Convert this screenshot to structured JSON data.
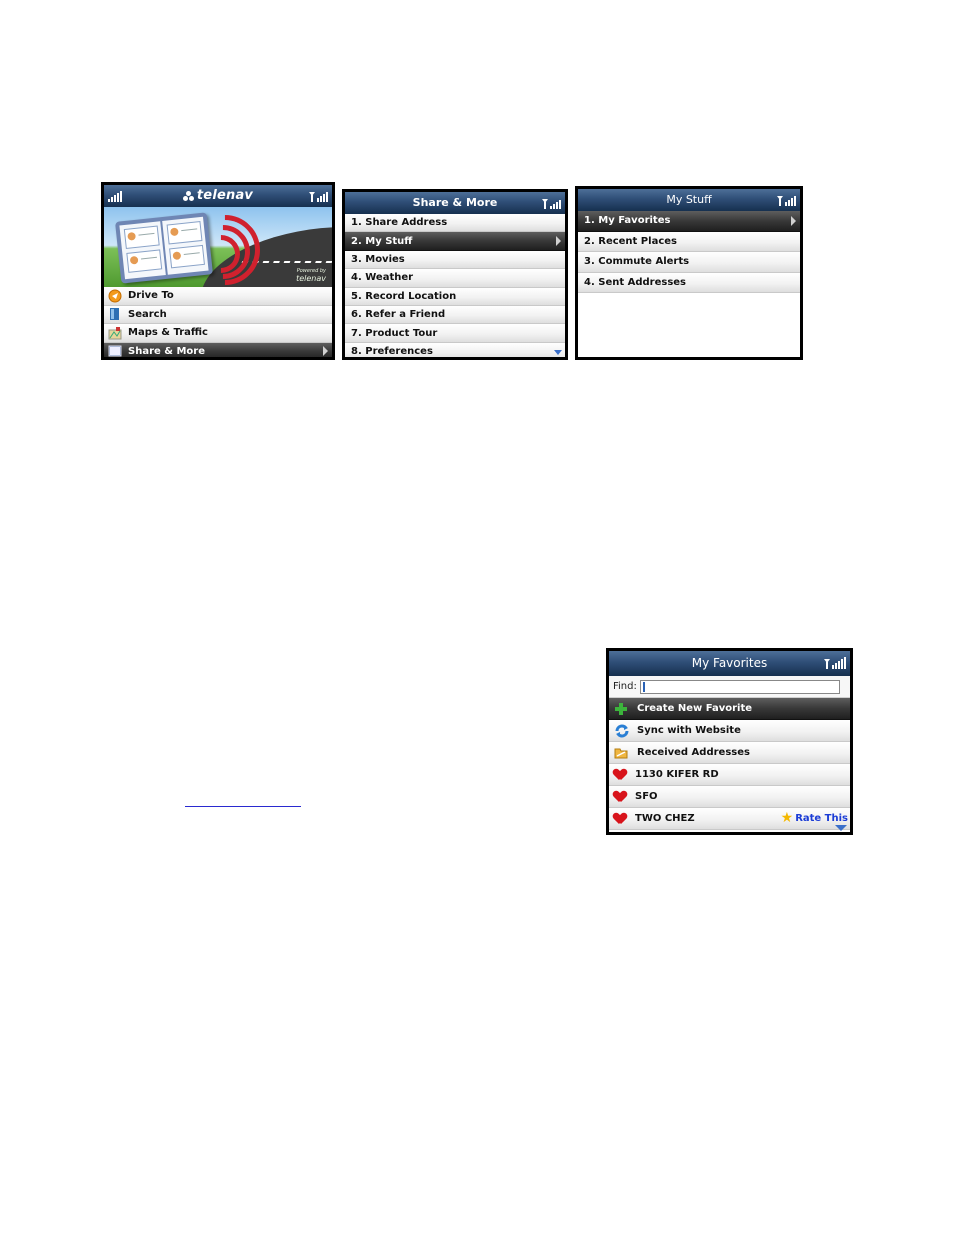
{
  "screen1": {
    "logo": "telenav",
    "powered_by": "Powered by",
    "powered_logo": "telenav",
    "items": [
      {
        "label": "Drive To",
        "icon": "drive-to-icon"
      },
      {
        "label": "Search",
        "icon": "search-book-icon"
      },
      {
        "label": "Maps & Traffic",
        "icon": "map-traffic-icon"
      },
      {
        "label": "Share & More",
        "icon": "share-more-icon",
        "selected": true
      }
    ]
  },
  "screen2": {
    "title": "Share & More",
    "items": [
      {
        "label": "1. Share Address"
      },
      {
        "label": "2. My Stuff",
        "selected": true
      },
      {
        "label": "3. Movies"
      },
      {
        "label": "4. Weather"
      },
      {
        "label": "5. Record Location"
      },
      {
        "label": "6. Refer a Friend"
      },
      {
        "label": "7. Product Tour"
      },
      {
        "label": "8. Preferences"
      }
    ]
  },
  "screen3": {
    "title": "My Stuff",
    "items": [
      {
        "label": "1. My Favorites",
        "selected": true
      },
      {
        "label": "2. Recent Places"
      },
      {
        "label": "3. Commute Alerts"
      },
      {
        "label": "4. Sent Addresses"
      }
    ]
  },
  "screen4": {
    "title": "My Favorites",
    "find_label": "Find:",
    "find_value": "",
    "items": [
      {
        "label": "Create New Favorite",
        "icon": "plus-icon",
        "selected": true
      },
      {
        "label": "Sync with Website",
        "icon": "sync-icon"
      },
      {
        "label": "Received Addresses",
        "icon": "folder-icon"
      },
      {
        "label": "1130 KIFER RD",
        "icon": "heart-icon"
      },
      {
        "label": "SFO",
        "icon": "heart-icon"
      },
      {
        "label": "TWO CHEZ",
        "icon": "heart-icon"
      }
    ],
    "rate_label": "Rate This"
  },
  "colors": {
    "titlebar": "#2f4e77",
    "selected_row": "#383838",
    "heart": "#d8141b",
    "rate_link": "#1c3dd6"
  }
}
